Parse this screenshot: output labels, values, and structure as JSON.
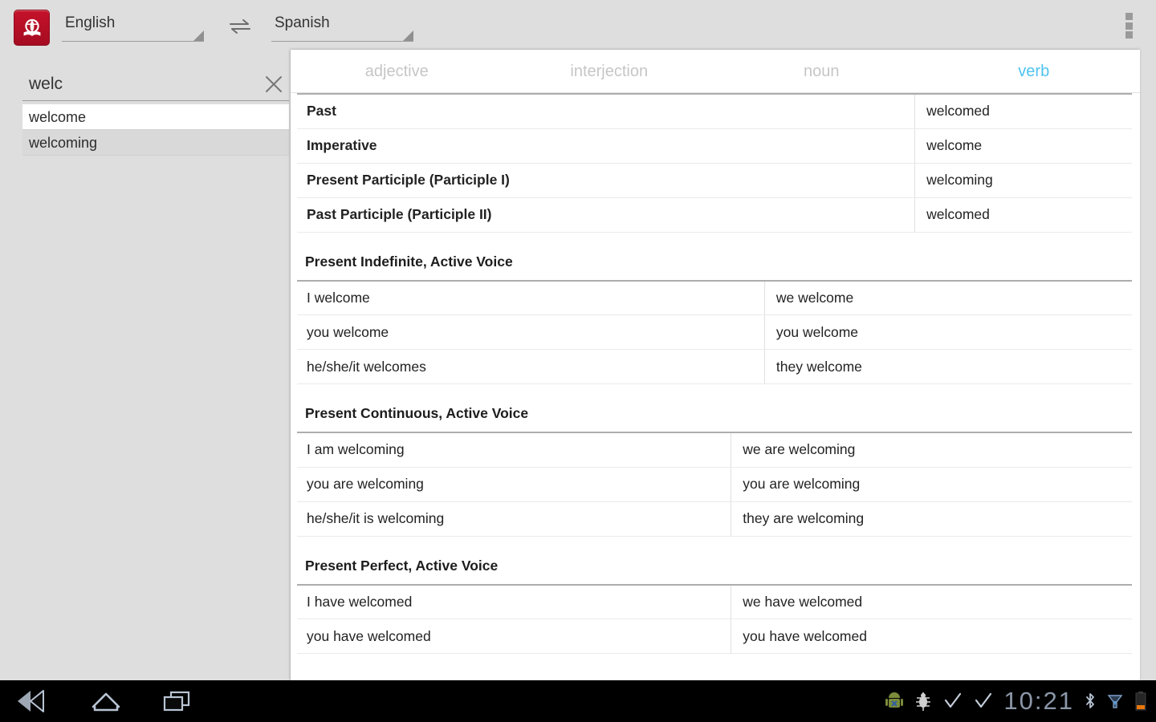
{
  "app": {
    "icon_name": "dictionary-globe-icon",
    "accent_blue": "#4ec3f0",
    "icon_red": "#b51026",
    "background_gray": "#dedede"
  },
  "topbar": {
    "source_language": "English",
    "target_language": "Spanish",
    "swap_icon": "swap-arrows-icon",
    "overflow_icon": "overflow-menu-icon"
  },
  "search": {
    "value": "welc",
    "placeholder": "",
    "clear_icon": "close-x-icon",
    "suggestions": [
      {
        "text": "welcome",
        "selected": true
      },
      {
        "text": "welcoming",
        "selected": false
      }
    ]
  },
  "tabs": [
    {
      "label": "adjective",
      "active": false
    },
    {
      "label": "interjection",
      "active": false
    },
    {
      "label": "noun",
      "active": false
    },
    {
      "label": "verb",
      "active": true
    }
  ],
  "forms_table": {
    "rows": [
      {
        "label": "Past",
        "value": "welcomed"
      },
      {
        "label": "Imperative",
        "value": "welcome"
      },
      {
        "label": "Present Participle (Participle I)",
        "value": "welcoming"
      },
      {
        "label": "Past Participle (Participle II)",
        "value": "welcomed"
      }
    ]
  },
  "sections": [
    {
      "title": "Present Indefinite, Active Voice",
      "split": 56,
      "rows": [
        {
          "singular": "I welcome",
          "plural": "we welcome"
        },
        {
          "singular": "you welcome",
          "plural": "you welcome"
        },
        {
          "singular": "he/she/it welcomes",
          "plural": "they welcome"
        }
      ]
    },
    {
      "title": "Present Continuous, Active Voice",
      "split": 52,
      "rows": [
        {
          "singular": "I am welcoming",
          "plural": "we are welcoming"
        },
        {
          "singular": "you are welcoming",
          "plural": "you are welcoming"
        },
        {
          "singular": "he/she/it is welcoming",
          "plural": "they are welcoming"
        }
      ]
    },
    {
      "title": "Present Perfect, Active Voice",
      "split": 52,
      "rows": [
        {
          "singular": "I have welcomed",
          "plural": "we have welcomed"
        },
        {
          "singular": "you have welcomed",
          "plural": "you have welcomed"
        }
      ]
    }
  ],
  "systembar": {
    "back_icon": "back-arrow-icon",
    "home_icon": "home-icon",
    "recents_icon": "recent-apps-icon",
    "clock": "10:21",
    "tray_icons": [
      "android-robot-icon",
      "bug-icon",
      "checkmark-icon",
      "checkmark-icon",
      "bluetooth-icon",
      "signal-icon",
      "battery-icon"
    ]
  }
}
